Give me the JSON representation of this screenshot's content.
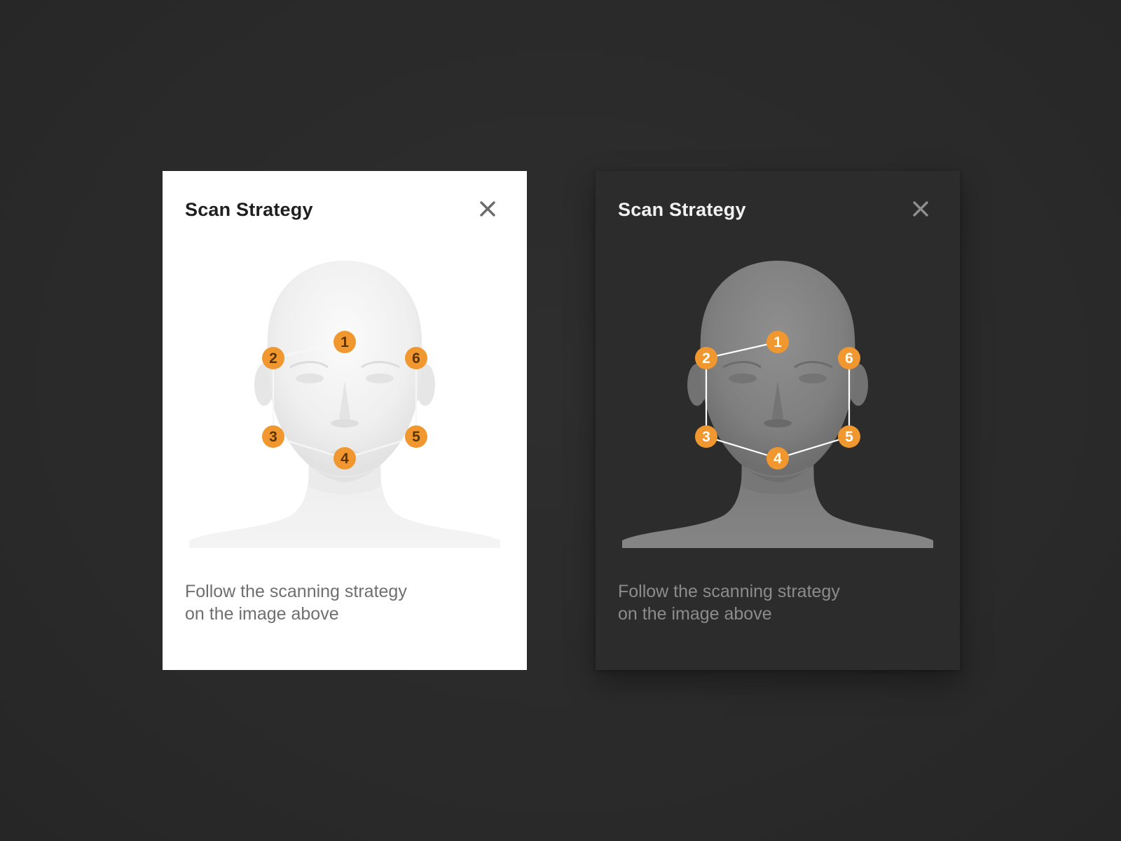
{
  "cards": [
    {
      "theme": "light",
      "title": "Scan Strategy",
      "close_icon": "close-icon",
      "caption_line1": "Follow the scanning strategy",
      "caption_line2": "on the image above",
      "markers": [
        "1",
        "2",
        "3",
        "4",
        "5",
        "6"
      ]
    },
    {
      "theme": "dark",
      "title": "Scan Strategy",
      "close_icon": "close-icon",
      "caption_line1": "Follow the scanning strategy",
      "caption_line2": "on the image above",
      "markers": [
        "1",
        "2",
        "3",
        "4",
        "5",
        "6"
      ]
    }
  ],
  "colors": {
    "marker_fill": "#f0982f",
    "marker_text_light": "#5a3405",
    "marker_text_dark": "#ffffff",
    "path_line": "#ffffff",
    "light_card_bg": "#ffffff",
    "dark_card_bg": "#2c2c2c",
    "page_bg": "#2b2b2b"
  }
}
